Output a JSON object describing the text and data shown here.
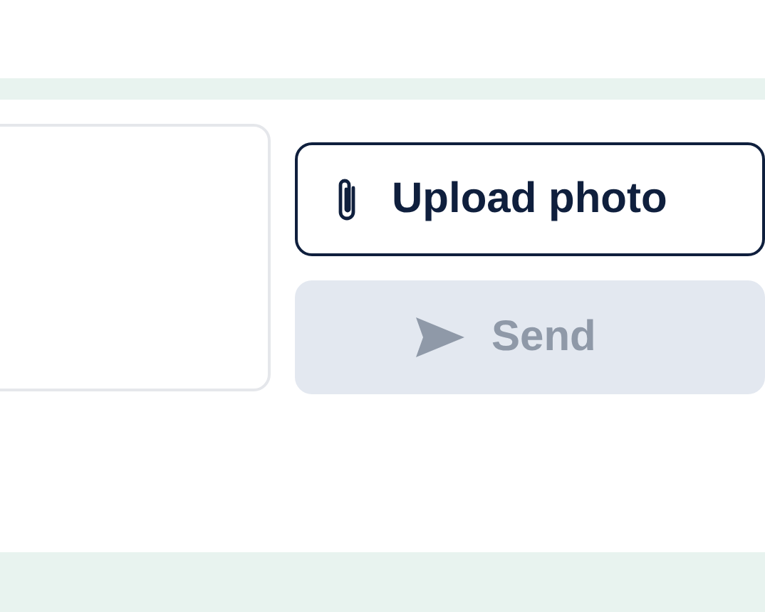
{
  "message_field": {
    "kind": "textarea"
  },
  "buttons": [
    {
      "label": "Upload photo",
      "kind": "upload",
      "disabled": false
    },
    {
      "label": "Send",
      "kind": "send",
      "disabled": true
    }
  ]
}
